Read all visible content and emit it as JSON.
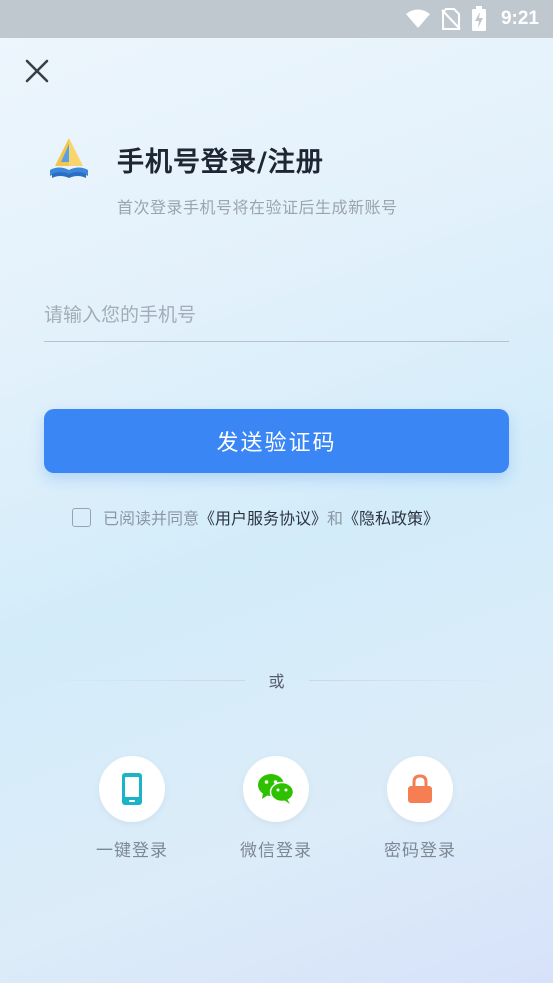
{
  "status_bar": {
    "time": "9:21"
  },
  "header": {
    "title": "手机号登录/注册",
    "subtitle": "首次登录手机号将在验证后生成新账号"
  },
  "form": {
    "phone_placeholder": "请输入您的手机号",
    "phone_value": "",
    "send_code_label": "发送验证码"
  },
  "agreement": {
    "prefix": "已阅读并同意",
    "user_agreement": "《用户服务协议》",
    "and": "和",
    "privacy_policy": "《隐私政策》",
    "checked": false
  },
  "divider": {
    "or": "或"
  },
  "alt_logins": [
    {
      "label": "一键登录",
      "icon": "phone-icon",
      "color": "#1ab3c8"
    },
    {
      "label": "微信登录",
      "icon": "wechat-icon",
      "color": "#2dc100"
    },
    {
      "label": "密码登录",
      "icon": "lock-icon",
      "color": "#f57e52"
    }
  ],
  "colors": {
    "primary": "#3a86f5",
    "status_bar": "#bfc7cf"
  }
}
